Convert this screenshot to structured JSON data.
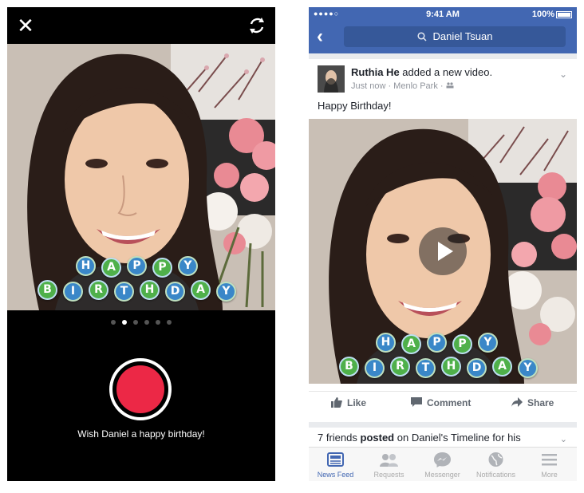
{
  "camera": {
    "close_icon": "close-icon",
    "flip_icon": "switch-camera-icon",
    "page_dots": {
      "count": 6,
      "active_index": 1
    },
    "caption": "Wish Daniel a happy birthday!",
    "overlay": {
      "line1": [
        "H",
        "A",
        "P",
        "P",
        "Y"
      ],
      "line2": [
        "B",
        "I",
        "R",
        "T",
        "H",
        "D",
        "A",
        "Y"
      ]
    }
  },
  "feed": {
    "status_bar": {
      "signal": "●●●●○",
      "time": "9:41 AM",
      "battery": "100%"
    },
    "search": {
      "value": "Daniel Tsuan"
    },
    "post": {
      "author": "Ruthia He",
      "action": "added a new video.",
      "meta": "Just now · Menlo Park · ",
      "text": "Happy Birthday!",
      "overlay": {
        "line1": [
          "H",
          "A",
          "P",
          "P",
          "Y"
        ],
        "line2": [
          "B",
          "I",
          "R",
          "T",
          "H",
          "D",
          "A",
          "Y"
        ]
      },
      "actions": {
        "like": "Like",
        "comment": "Comment",
        "share": "Share"
      }
    },
    "friends_story": {
      "prefix": "7 friends",
      "verb": "posted",
      "rest": "on Daniel's Timeline for his"
    },
    "tabs": [
      "News Feed",
      "Requests",
      "Messenger",
      "Notifications",
      "More"
    ]
  },
  "colors": {
    "fb_blue": "#4267b2",
    "record_red": "#ec2846",
    "bubble_blue": "#3a87c8",
    "bubble_green": "#4fb04a"
  }
}
